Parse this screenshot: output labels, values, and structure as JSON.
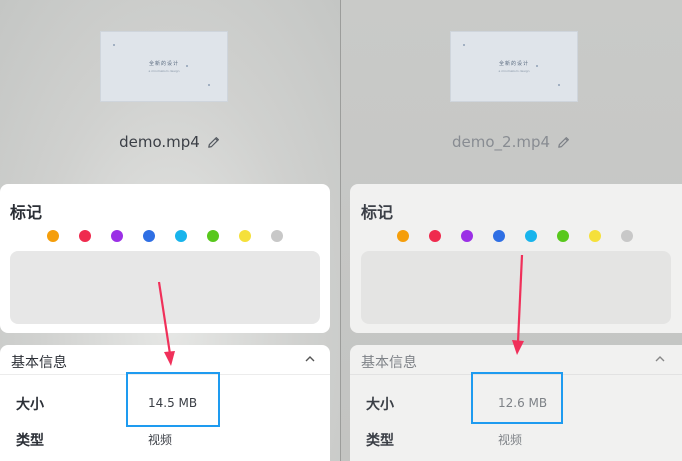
{
  "colors": {
    "tag_dots": [
      "#f59e0b",
      "#ef2b4e",
      "#9b30e6",
      "#2f6fe4",
      "#18b4ec",
      "#58c81c",
      "#f5e03a",
      "#c8c8c8"
    ],
    "highlight": "#1e9bf0",
    "arrow": "#f0305a"
  },
  "left": {
    "thumbnail": {
      "title": "全新的设计",
      "subtitle": "a minimalism design"
    },
    "filename": "demo.mp4",
    "tags_title": "标记",
    "info": {
      "title": "基本信息",
      "rows": [
        {
          "label": "大小",
          "value": "14.5 MB"
        },
        {
          "label": "类型",
          "value": "视频"
        }
      ]
    }
  },
  "right": {
    "thumbnail": {
      "title": "全新的设计",
      "subtitle": "a minimalism design"
    },
    "filename": "demo_2.mp4",
    "tags_title": "标记",
    "info": {
      "title": "基本信息",
      "rows": [
        {
          "label": "大小",
          "value": "12.6 MB"
        },
        {
          "label": "类型",
          "value": "视频"
        }
      ]
    }
  },
  "icons": {
    "edit": "pencil-icon",
    "collapse": "chevron-up-icon"
  }
}
